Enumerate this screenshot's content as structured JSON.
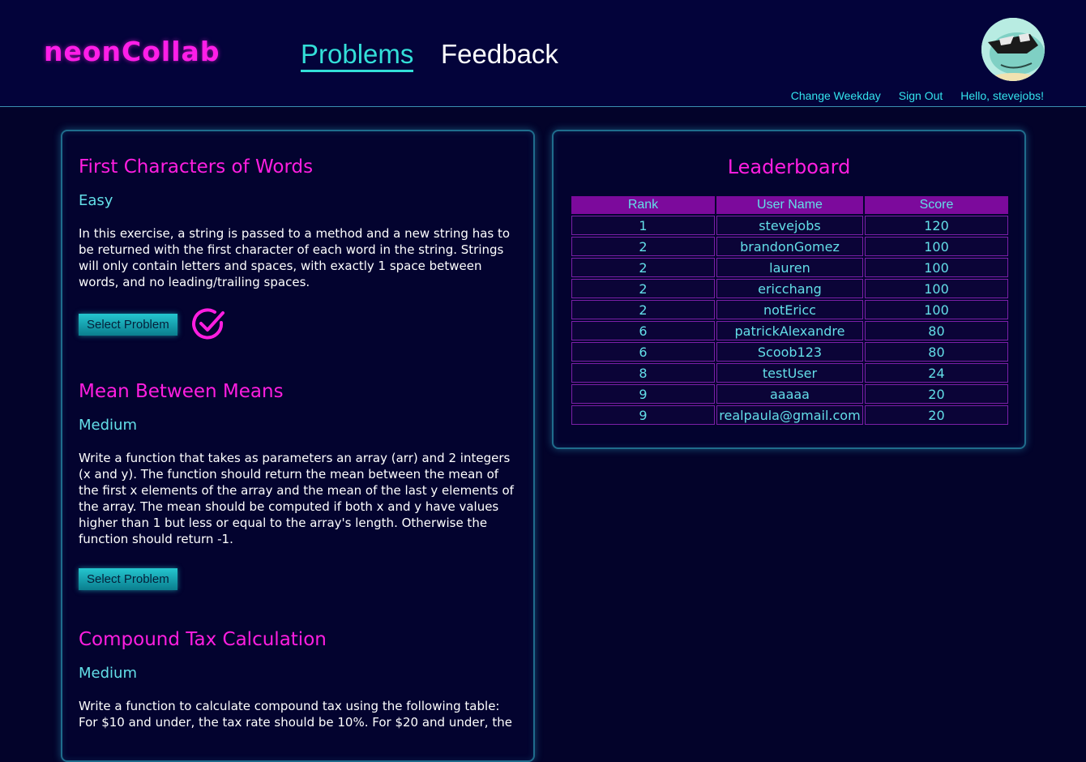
{
  "header": {
    "logo": "neonCollab",
    "tabs": [
      {
        "label": "Problems",
        "active": true
      },
      {
        "label": "Feedback",
        "active": false
      }
    ],
    "links": {
      "change_weekday": "Change Weekday",
      "sign_out": "Sign Out",
      "greeting": "Hello, stevejobs!"
    },
    "avatar_icon": "cartoon-avatar-icon"
  },
  "problems": [
    {
      "title": "First Characters of Words",
      "difficulty": "Easy",
      "description": "In this exercise, a string is passed to a method and a new string has to be returned with the first character of each word in the string. Strings will only contain letters and spaces, with exactly 1 space between words, and no leading/trailing spaces.",
      "button": "Select Problem",
      "completed": true
    },
    {
      "title": "Mean Between Means",
      "difficulty": "Medium",
      "description": "Write a function that takes as parameters an array (arr) and 2 integers (x and y). The function should return the mean between the mean of the first x elements of the array and the mean of the last y elements of the array. The mean should be computed if both x and y have values higher than 1 but less or equal to the array's length. Otherwise the function should return -1.",
      "button": "Select Problem",
      "completed": false
    },
    {
      "title": "Compound Tax Calculation",
      "difficulty": "Medium",
      "description": "Write a function to calculate compound tax using the following table: For $10 and under, the tax rate should be 10%. For $20 and under, the",
      "button": "Select Problem",
      "completed": false
    }
  ],
  "leaderboard": {
    "title": "Leaderboard",
    "headers": {
      "rank": "Rank",
      "user": "User Name",
      "score": "Score"
    },
    "rows": [
      {
        "rank": "1",
        "user": "stevejobs",
        "score": "120"
      },
      {
        "rank": "2",
        "user": "brandonGomez",
        "score": "100"
      },
      {
        "rank": "2",
        "user": "lauren",
        "score": "100"
      },
      {
        "rank": "2",
        "user": "ericchang",
        "score": "100"
      },
      {
        "rank": "2",
        "user": "notEricc",
        "score": "100"
      },
      {
        "rank": "6",
        "user": "patrickAlexandre",
        "score": "80"
      },
      {
        "rank": "6",
        "user": "Scoob123",
        "score": "80"
      },
      {
        "rank": "8",
        "user": "testUser",
        "score": "24"
      },
      {
        "rank": "9",
        "user": "aaaaa",
        "score": "20"
      },
      {
        "rank": "9",
        "user": "realpaula@gmail.com",
        "score": "20"
      }
    ]
  },
  "colors": {
    "background": "#03032a",
    "accent_magenta": "#ff1ee0",
    "accent_cyan": "#33dfd8"
  }
}
